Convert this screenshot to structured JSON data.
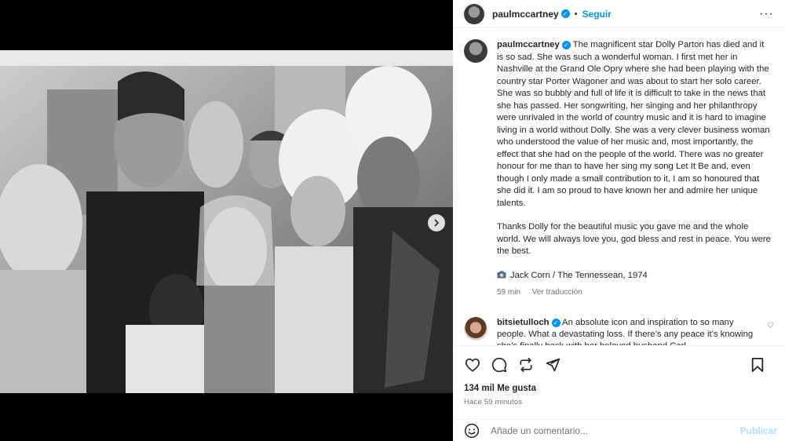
{
  "post": {
    "username": "paulmccartney",
    "follow_label": "Seguir",
    "separator": "•",
    "more_icon": "more-horizontal-icon",
    "caption_p1": "The magnificent star Dolly Parton has died and it is so sad. She was such a wonderful woman. I first met her in Nashville at the Grand Ole Opry where she had been playing with the country star Porter Wagoner and was about to start her solo career. She was so bubbly and full of life it is difficult to take in the news that she has passed. Her songwriting, her singing and her philanthropy were unrivaled in the world of country music and it is hard to imagine living in a world without Dolly. She was a very clever business woman who understood the value of her music and, most importantly, the effect that she had on the people of the world. There was no greater honour for me than to have her sing my song Let It Be and, even though I only made a small contribution to it, I am so honoured that she did it. I am so proud to have known her and admire her unique talents.",
    "caption_p2": "Thanks Dolly for the beautiful music you gave me and the whole world. We will always love you, god bless and rest in peace. You were the best.",
    "credit_icon": "camera-icon",
    "credit": "Jack Corn / The Tennessean, 1974",
    "caption_time": "59 min",
    "translate_label": "Ver traducción"
  },
  "comment": {
    "username": "bitsietulloch",
    "text": "An absolute icon and inspiration to so many people. What a devastating loss. If there’s any peace it’s knowing she’s finally back with her beloved husband Carl"
  },
  "engagement": {
    "likes": "134 mil Me gusta",
    "posted_ago": "Hace 59 minutos"
  },
  "composer": {
    "placeholder": "Añade un comentario...",
    "publish_label": "Publicar"
  },
  "colors": {
    "accent": "#0095f6",
    "publish_disabled": "#b2dffc",
    "text": "#262626",
    "muted": "#737373"
  }
}
